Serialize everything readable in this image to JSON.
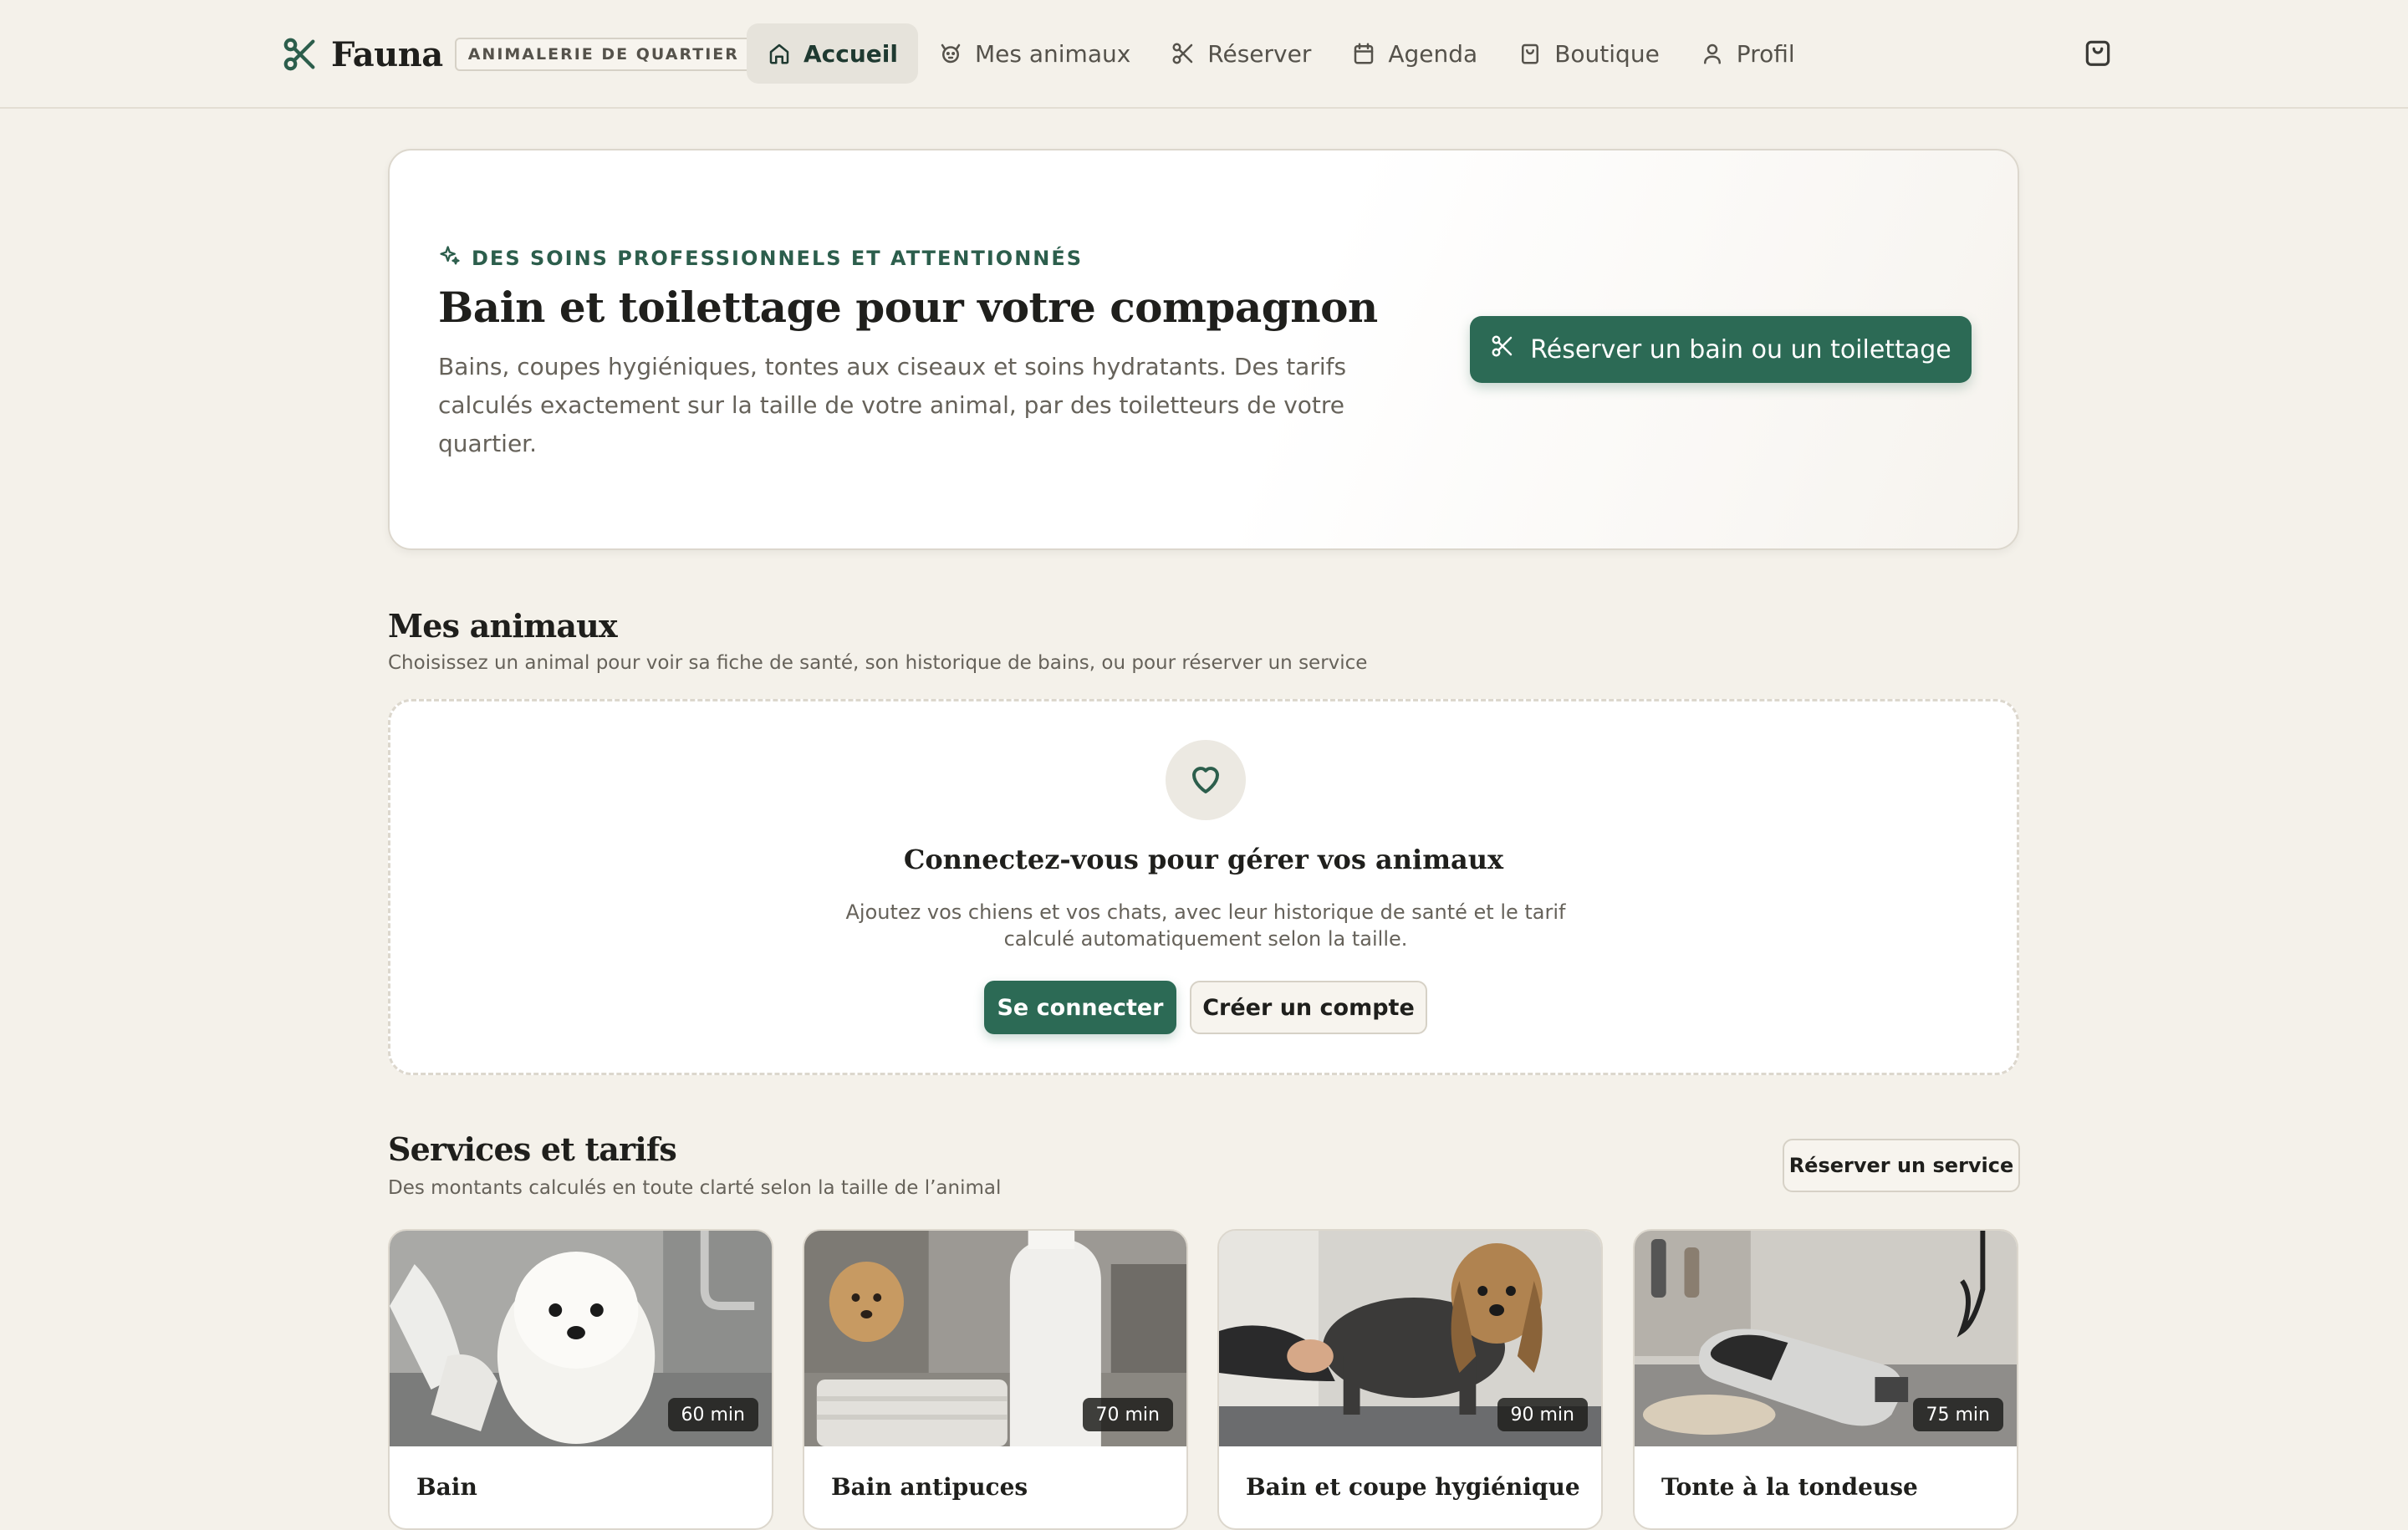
{
  "header": {
    "brand_name": "Fauna",
    "brand_tag": "ANIMALERIE DE QUARTIER",
    "nav": [
      {
        "label": "Accueil",
        "icon": "home-icon",
        "active": true
      },
      {
        "label": "Mes animaux",
        "icon": "pet-icon",
        "active": false
      },
      {
        "label": "Réserver",
        "icon": "scissors-icon",
        "active": false
      },
      {
        "label": "Agenda",
        "icon": "calendar-icon",
        "active": false
      },
      {
        "label": "Boutique",
        "icon": "shopping-bag-icon",
        "active": false
      },
      {
        "label": "Profil",
        "icon": "user-icon",
        "active": false
      }
    ],
    "cart_icon": "cart-icon"
  },
  "hero": {
    "eyebrow": "DES SOINS PROFESSIONNELS ET ATTENTIONNÉS",
    "title": "Bain et toilettage pour votre compagnon",
    "text": "Bains, coupes hygiéniques, tontes aux ciseaux et soins hydratants. Des tarifs calculés exactement sur la taille de votre animal, par des toiletteurs de votre quartier.",
    "cta": "Réserver un bain ou un toilettage"
  },
  "pets": {
    "title": "Mes animaux",
    "subtitle": "Choisissez un animal pour voir sa fiche de santé, son historique de bains, ou pour réserver un service",
    "empty": {
      "title": "Connectez-vous pour gérer vos animaux",
      "text": "Ajoutez vos chiens et vos chats, avec leur historique de santé et le tarif calculé automatiquement selon la taille.",
      "login": "Se connecter",
      "signup": "Créer un compte"
    }
  },
  "services": {
    "title": "Services et tarifs",
    "subtitle": "Des montants calculés en toute clarté selon la taille de l’animal",
    "book_button": "Réserver un service",
    "items": [
      {
        "name": "Bain",
        "duration": "60 min"
      },
      {
        "name": "Bain antipuces",
        "duration": "70 min"
      },
      {
        "name": "Bain et coupe hygiénique",
        "duration": "90 min"
      },
      {
        "name": "Tonte à la tondeuse",
        "duration": "75 min"
      }
    ]
  },
  "colors": {
    "accent": "#2c6a55",
    "background": "#f4f1ea"
  }
}
